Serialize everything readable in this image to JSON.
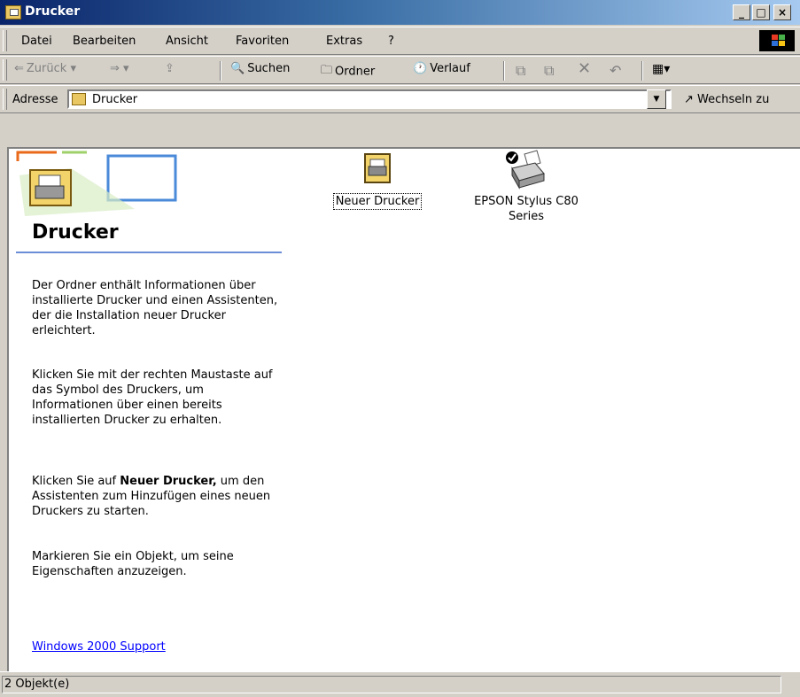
{
  "window": {
    "title": "Drucker"
  },
  "menu": [
    "Datei",
    "Bearbeiten",
    "Ansicht",
    "Favoriten",
    "Extras",
    "?"
  ],
  "toolbar": {
    "back": "Zurück",
    "search": "Suchen",
    "folders": "Ordner",
    "history": "Verlauf"
  },
  "address": {
    "label": "Adresse",
    "value": "Drucker",
    "go": "Wechseln zu"
  },
  "panel": {
    "title": "Drucker",
    "p1": "Der Ordner enthält Informationen über installierte Drucker und einen Assistenten, der die Installation neuer Drucker erleichtert.",
    "p2": "Klicken Sie mit der rechten Maustaste auf das Symbol des Druckers, um Informationen über einen bereits installierten Drucker zu erhalten.",
    "p3_pre": "Klicken Sie auf ",
    "p3_bold": "Neuer Drucker,",
    "p3_post": " um den Assistenten zum Hinzufügen eines neuen Druckers zu starten.",
    "p4": "Markieren Sie ein Objekt, um seine Eigenschaften anzuzeigen.",
    "link": "Windows 2000 Support"
  },
  "items": [
    {
      "label": "Neuer Drucker"
    },
    {
      "label": "EPSON Stylus C80 Series"
    }
  ],
  "status": {
    "text": "2 Objekt(e)"
  }
}
